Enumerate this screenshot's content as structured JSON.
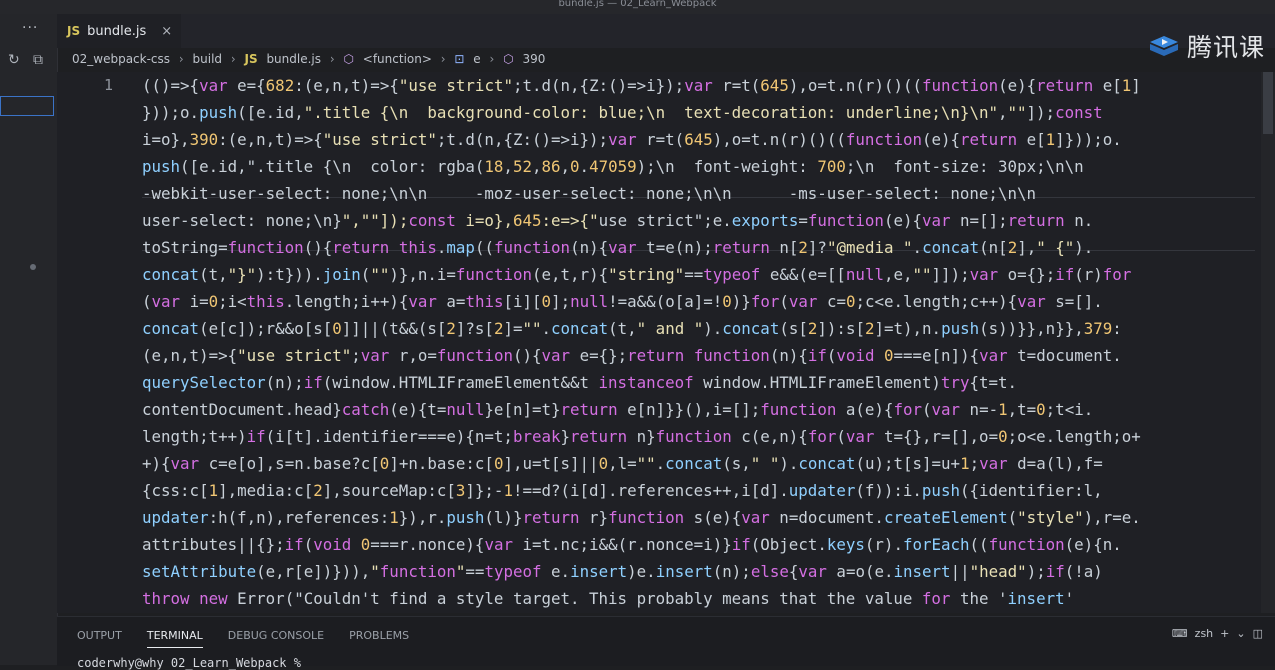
{
  "window": {
    "title": "bundle.js — 02_Learn_Webpack"
  },
  "brand": {
    "name": "腾讯课"
  },
  "tab": {
    "lang": "JS",
    "name": "bundle.js",
    "close": "×"
  },
  "breadcrumbs": [
    "02_webpack-css",
    "build",
    "bundle.js",
    "<function>",
    "e",
    "390"
  ],
  "editor": {
    "line_number": "1",
    "lines": [
      "(()=>{var e={682:(e,n,t)=>{\"use strict\";t.d(n,{Z:()=>i});var r=t(645),o=t.n(r)()((function(e){return e[1]",
      "}));o.push([e.id,\".title {\\n  background-color: blue;\\n  text-decoration: underline;\\n}\\n\",\"\"]);const",
      "i=o},390:(e,n,t)=>{\"use strict\";t.d(n,{Z:()=>i});var r=t(645),o=t.n(r)()((function(e){return e[1]}));o.",
      "push([e.id,\".title {\\n  color: rgba(18,52,86,0.47059);\\n  font-weight: 700;\\n  font-size: 30px;\\n\\n",
      "-webkit-user-select: none;\\n\\n     -moz-user-select: none;\\n\\n      -ms-user-select: none;\\n\\n",
      "user-select: none;\\n}\",\"\"]);const i=o},645:e=>{\"use strict\";e.exports=function(e){var n=[];return n.",
      "toString=function(){return this.map((function(n){var t=e(n);return n[2]?\"@media \".concat(n[2],\" {\").",
      "concat(t,\"}\"):t})).join(\"\")},n.i=function(e,t,r){\"string\"==typeof e&&(e=[[null,e,\"\"]]);var o={};if(r)for",
      "(var i=0;i<this.length;i++){var a=this[i][0];null!=a&&(o[a]=!0)}for(var c=0;c<e.length;c++){var s=[].",
      "concat(e[c]);r&&o[s[0]]||(t&&(s[2]?s[2]=\"\".concat(t,\" and \").concat(s[2]):s[2]=t),n.push(s))}},n}},379:",
      "(e,n,t)=>{\"use strict\";var r,o=function(){var e={};return function(n){if(void 0===e[n]){var t=document.",
      "querySelector(n);if(window.HTMLIFrameElement&&t instanceof window.HTMLIFrameElement)try{t=t.",
      "contentDocument.head}catch(e){t=null}e[n]=t}return e[n]}}(),i=[];function a(e){for(var n=-1,t=0;t<i.",
      "length;t++)if(i[t].identifier===e){n=t;break}return n}function c(e,n){for(var t={},r=[],o=0;o<e.length;o+",
      "+){var c=e[o],s=n.base?c[0]+n.base:c[0],u=t[s]||0,l=\"\".concat(s,\" \").concat(u);t[s]=u+1;var d=a(l),f=",
      "{css:c[1],media:c[2],sourceMap:c[3]};-1!==d?(i[d].references++,i[d].updater(f)):i.push({identifier:l,",
      "updater:h(f,n),references:1}),r.push(l)}return r}function s(e){var n=document.createElement(\"style\"),r=e.",
      "attributes||{};if(void 0===r.nonce){var i=t.nc;i&&(r.nonce=i)}if(Object.keys(r).forEach((function(e){n.",
      "setAttribute(e,r[e])})),\"function\"==typeof e.insert)e.insert(n);else{var a=o(e.insert||\"head\");if(!a)",
      "throw new Error(\"Couldn't find a style target. This probably means that the value for the 'insert'"
    ]
  },
  "panel": {
    "tabs": [
      "OUTPUT",
      "TERMINAL",
      "DEBUG CONSOLE",
      "PROBLEMS"
    ],
    "active": "TERMINAL",
    "shell": "zsh",
    "prompt_line": "coderwhy@why 02_Learn_Webpack %"
  }
}
